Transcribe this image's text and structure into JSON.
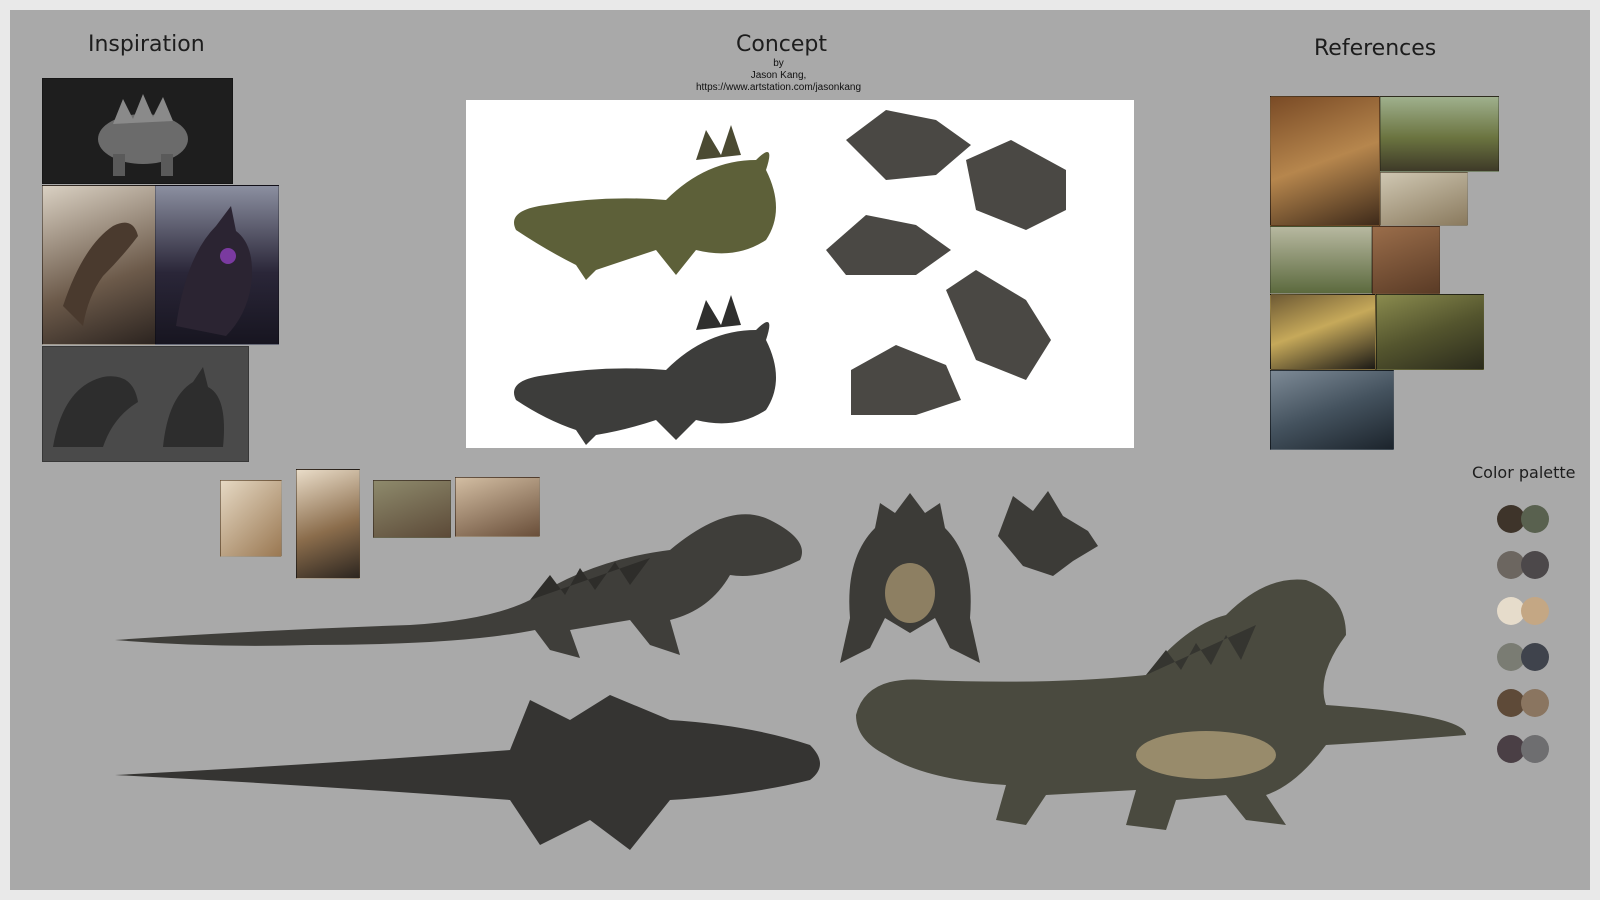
{
  "headings": {
    "inspiration": "Inspiration",
    "concept": "Concept",
    "references": "References",
    "color_palette": "Color palette"
  },
  "credit": {
    "by": "by",
    "artist": "Jason Kang,",
    "url": "https://www.artstation.com/jasonkang"
  },
  "palette": [
    [
      "#3e342a",
      "#59614f"
    ],
    [
      "#6c6660",
      "#4c484a"
    ],
    [
      "#e6dccb",
      "#c4a784"
    ],
    [
      "#7a7c73",
      "#3f434c"
    ],
    [
      "#5e4a38",
      "#8a7560"
    ],
    [
      "#4a3f45",
      "#6e6e70"
    ]
  ],
  "colors": {
    "board": "#a9a9a9",
    "frame": "#e9e9e9",
    "sheet": "#ffffff",
    "creature_green": "#5d6039",
    "creature_dark": "#3d3d3b",
    "belly": "#c2b08c"
  }
}
